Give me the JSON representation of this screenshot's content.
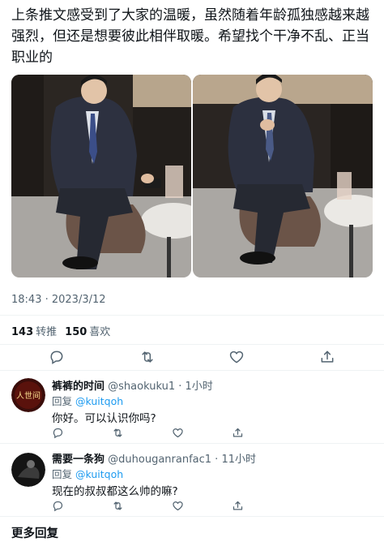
{
  "tweet": {
    "text": "上条推文感受到了大家的温暖，虽然随着年龄孤独感越来越强烈，但还是想要彼此相伴取暖。希望找个干净不乱、正当职业的",
    "time": "18:43 · 2023/3/12",
    "retweets_count": "143",
    "retweets_label": "转推",
    "likes_count": "150",
    "likes_label": "喜欢"
  },
  "icons": {
    "reply": "reply-icon",
    "retweet": "retweet-icon",
    "like": "heart-icon",
    "share": "share-icon"
  },
  "replies": [
    {
      "name": "裤裤的时间",
      "handle": "@shaokuku1 · 1小时",
      "reply_prefix": "回复",
      "reply_to": "@kuitqoh",
      "text": "你好。可以认识你吗?",
      "avatar_text": "人世间"
    },
    {
      "name": "需要一条狗",
      "handle": "@duhouganranfac1 · 11小时",
      "reply_prefix": "回复",
      "reply_to": "@kuitqoh",
      "text": "现在的叔叔都这么帅的嘛?"
    }
  ],
  "more_replies_label": "更多回复",
  "colors": {
    "text": "#0f1419",
    "secondary": "#536471",
    "link": "#1d9bf0",
    "divider": "#eff3f4"
  }
}
